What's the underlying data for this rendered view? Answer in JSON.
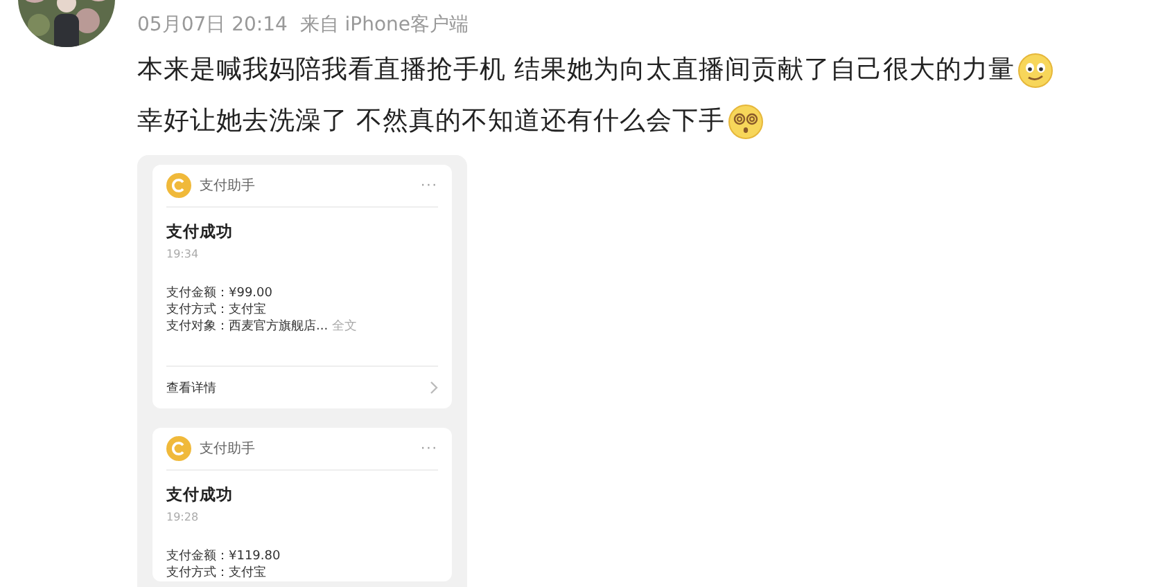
{
  "post": {
    "meta": "05月07日 20:14  来自 iPhone客户端",
    "lines": [
      {
        "text": "本来是喊我妈陪我看直播抢手机 结果她为向太直播间贡献了自己很大的力量",
        "emoji": {
          "kind": "sly"
        }
      },
      {
        "text": "幸好让她去洗澡了 不然真的不知道还有什么会下手",
        "emoji": {
          "kind": "dizzy"
        }
      }
    ]
  },
  "screenshot": {
    "kind": "picture",
    "cards": [
      {
        "sender": "支付助手",
        "more": "···",
        "title": "支付成功",
        "time": "19:34",
        "fields": [
          {
            "text": "支付金额：¥99.00"
          },
          {
            "text": "支付方式：支付宝"
          },
          {
            "text": "支付对象：西麦官方旗舰店...",
            "link": "全文"
          }
        ],
        "footer": "查看详情"
      },
      {
        "sender": "支付助手",
        "more": "···",
        "title": "支付成功",
        "time": "19:28",
        "fields": [
          {
            "text": "支付金额：¥119.80"
          },
          {
            "text": "支付方式：支付宝"
          }
        ]
      }
    ]
  }
}
